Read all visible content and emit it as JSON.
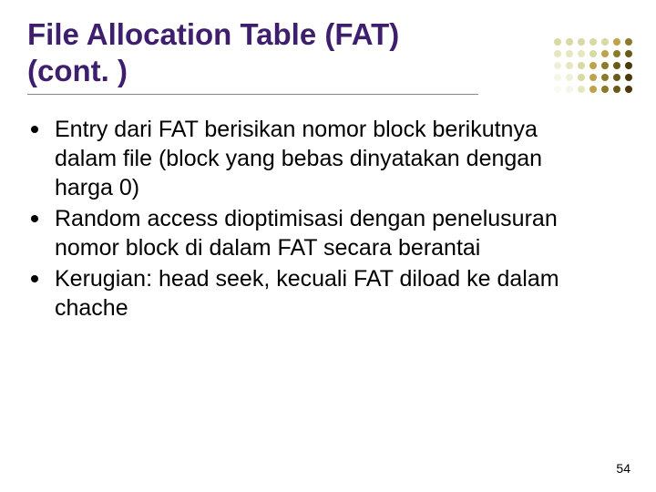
{
  "title": "File Allocation Table (FAT) (cont. )",
  "bullets": [
    "Entry dari FAT berisikan nomor block berikutnya dalam file (block yang bebas dinyatakan dengan harga 0)",
    "Random access dioptimisasi dengan penelusuran nomor block di dalam FAT secara berantai",
    "Kerugian: head seek, kecuali FAT diload ke dalam chache"
  ],
  "page_number": "54",
  "decoration_colors": {
    "row1": [
      "#d9d9a3",
      "#d9d9a3",
      "#d9d9a3",
      "#d9d9a3",
      "#d9d9a3",
      "#bfa34a",
      "#8a7a2a"
    ],
    "row2": [
      "#e6e6c0",
      "#e6e6c0",
      "#e6e6c0",
      "#d9d9a3",
      "#bfa34a",
      "#8a7a2a",
      "#6a5a1a"
    ],
    "row3": [
      "#f0f0da",
      "#e6e6c0",
      "#d9d9a3",
      "#bfa34a",
      "#8a7a2a",
      "#6a5a1a",
      "#4a3a0a"
    ],
    "row4": [
      "#f5f5e8",
      "#f0f0da",
      "#d9d9a3",
      "#bfa34a",
      "#8a7a2a",
      "#6a5a1a",
      "#4a3a0a"
    ],
    "row5": [
      "#fafaf2",
      "#f5f5e8",
      "#e6e6c0",
      "#bfa34a",
      "#8a7a2a",
      "#6a5a1a",
      "#4a3a0a"
    ]
  }
}
